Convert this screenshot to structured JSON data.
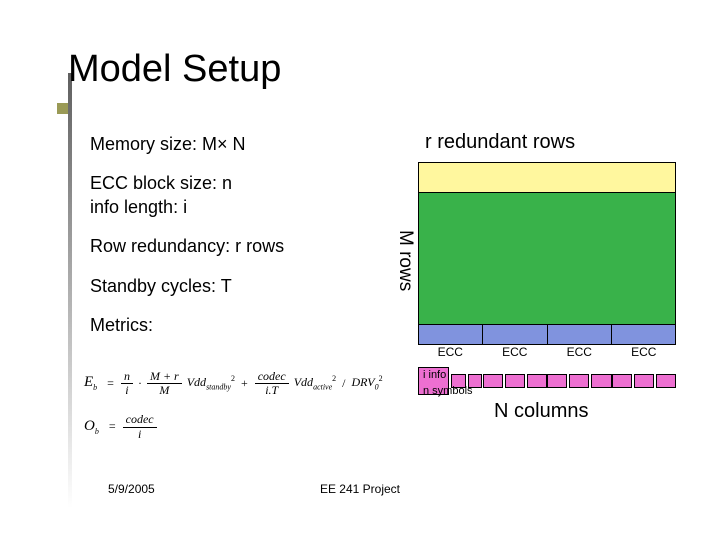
{
  "title": "Model Setup",
  "bullets": {
    "memory_size": "Memory size: M× N",
    "ecc_block": "ECC block size: n",
    "info_length": "info length: i",
    "row_redundancy": "Row redundancy: r rows",
    "standby_cycles": "Standby cycles: T",
    "metrics": "Metrics:"
  },
  "diagram": {
    "redundant_rows": "r redundant rows",
    "m_rows": "M rows",
    "ecc": "ECC",
    "i_info": "i info",
    "n_symbols": "n symbols",
    "n_columns": "N columns"
  },
  "formulas": {
    "eb_lhs": "E",
    "eb_sub": "b",
    "eq": "=",
    "frac1_num": "n",
    "frac1_den": "i",
    "dot": "·",
    "frac2_num": "M + r",
    "frac2_den": "M",
    "vdd_standby": "Vdd",
    "vdd_standby_sub": "standby",
    "sq": "2",
    "plus": "+",
    "frac3_num": "codec",
    "frac3_den": "i.T",
    "vdd_active": "Vdd",
    "vdd_active_sub": "active",
    "slash": "/",
    "drv": "DRV",
    "drv_sub": "0",
    "ob_lhs": "O",
    "ob_sub": "b",
    "ob_frac_num": "codec",
    "ob_frac_den": "i"
  },
  "footer": {
    "date": "5/9/2005",
    "center": "EE 241 Project"
  }
}
